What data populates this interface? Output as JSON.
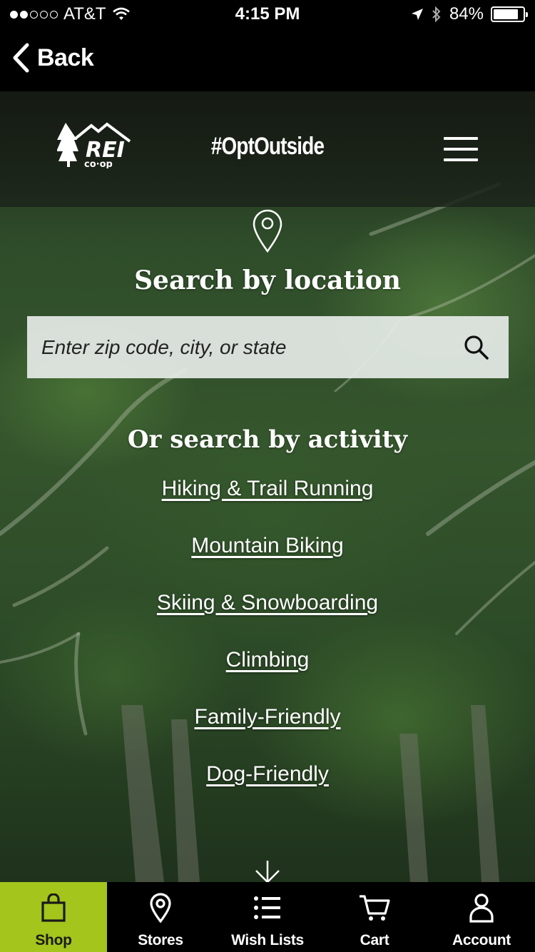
{
  "status_bar": {
    "carrier": "AT&T",
    "time": "4:15 PM",
    "battery": "84%",
    "battery_level": 0.84,
    "signal_bars_filled": 2,
    "signal_bars_total": 5
  },
  "nav": {
    "back_label": "Back"
  },
  "header": {
    "logo_text": "REI co-op",
    "hashtag": "#OptOutside"
  },
  "location_search": {
    "title": "Search by location",
    "placeholder": "Enter zip code, city, or state",
    "value": ""
  },
  "activity_search": {
    "title": "Or search by activity",
    "items": [
      {
        "label": "Hiking & Trail Running"
      },
      {
        "label": "Mountain Biking"
      },
      {
        "label": "Skiing & Snowboarding"
      },
      {
        "label": "Climbing"
      },
      {
        "label": "Family-Friendly"
      },
      {
        "label": "Dog-Friendly"
      }
    ]
  },
  "tab_bar": {
    "tabs": [
      {
        "label": "Shop",
        "icon": "shopping-bag-icon",
        "active": true
      },
      {
        "label": "Stores",
        "icon": "map-pin-icon",
        "active": false
      },
      {
        "label": "Wish Lists",
        "icon": "list-icon",
        "active": false
      },
      {
        "label": "Cart",
        "icon": "cart-icon",
        "active": false
      },
      {
        "label": "Account",
        "icon": "person-icon",
        "active": false
      }
    ]
  },
  "colors": {
    "accent": "#a3c51c",
    "background": "#000000",
    "search_box": "#e6ece8"
  }
}
